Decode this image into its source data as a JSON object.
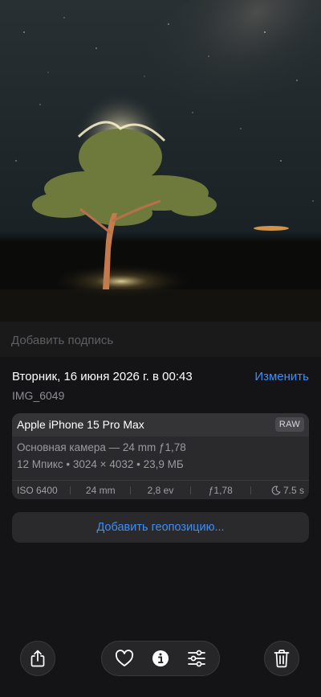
{
  "caption": {
    "placeholder": "Добавить подпись"
  },
  "info": {
    "date": "Вторник, 16 июня 2026 г. в 00:43",
    "edit_label": "Изменить",
    "filename": "IMG_6049"
  },
  "camera": {
    "device": "Apple iPhone 15 Pro Max",
    "format_badge": "RAW",
    "lens": "Основная камера — 24 mm ƒ1,78",
    "size": "12 Мпикс • 3024 × 4032 • 23,9 МБ",
    "exif": {
      "iso": "ISO 6400",
      "focal": "24 mm",
      "exposure_bias": "2,8 ev",
      "aperture": "ƒ1,78",
      "shutter": "7.5 s"
    }
  },
  "location": {
    "add_label": "Добавить геопозицию..."
  },
  "toolbar": {
    "share_icon": "share-icon",
    "favorite_icon": "heart-icon",
    "info_icon": "info-icon",
    "adjust_icon": "sliders-icon",
    "delete_icon": "trash-icon"
  },
  "colors": {
    "accent": "#3d8ef7",
    "background": "#141416",
    "card": "#2a2a2d"
  }
}
